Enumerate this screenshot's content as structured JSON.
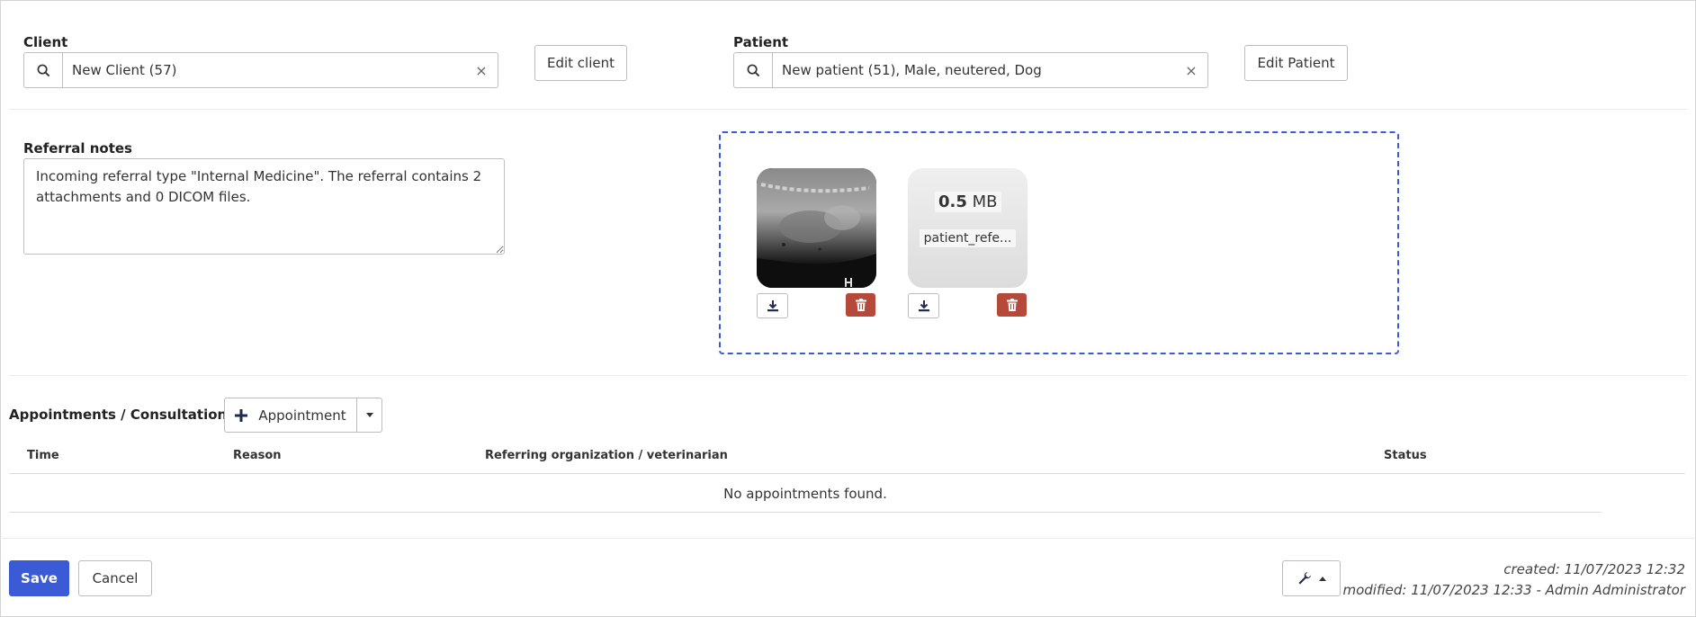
{
  "client": {
    "label": "Client",
    "value": "New Client (57)",
    "clear": "×",
    "edit_label": "Edit client"
  },
  "patient": {
    "label": "Patient",
    "value": "New patient (51), Male, neutered, Dog",
    "clear": "×",
    "edit_label": "Edit Patient"
  },
  "referral": {
    "label": "Referral notes",
    "text": "Incoming referral type \"Internal Medicine\". The referral contains 2 attachments and 0 DICOM files."
  },
  "attachments": [
    {
      "type": "image",
      "icon": "xray-thumbnail"
    },
    {
      "type": "file",
      "size_value": "0.5",
      "size_unit": "MB",
      "filename": "patient_refe..."
    }
  ],
  "appointments": {
    "title": "Appointments / Consultation",
    "add_label": "Appointment",
    "columns": [
      "Time",
      "Reason",
      "Referring organization / veterinarian",
      "Status"
    ],
    "empty": "No appointments found."
  },
  "footer": {
    "save_label": "Save",
    "cancel_label": "Cancel",
    "created": "created: 11/07/2023 12:32",
    "modified": "modified: 11/07/2023 12:33 - Admin Administrator"
  },
  "colors": {
    "primary": "#3b5bd6",
    "danger": "#b5493a",
    "dropzone_border": "#3b5bd6"
  }
}
